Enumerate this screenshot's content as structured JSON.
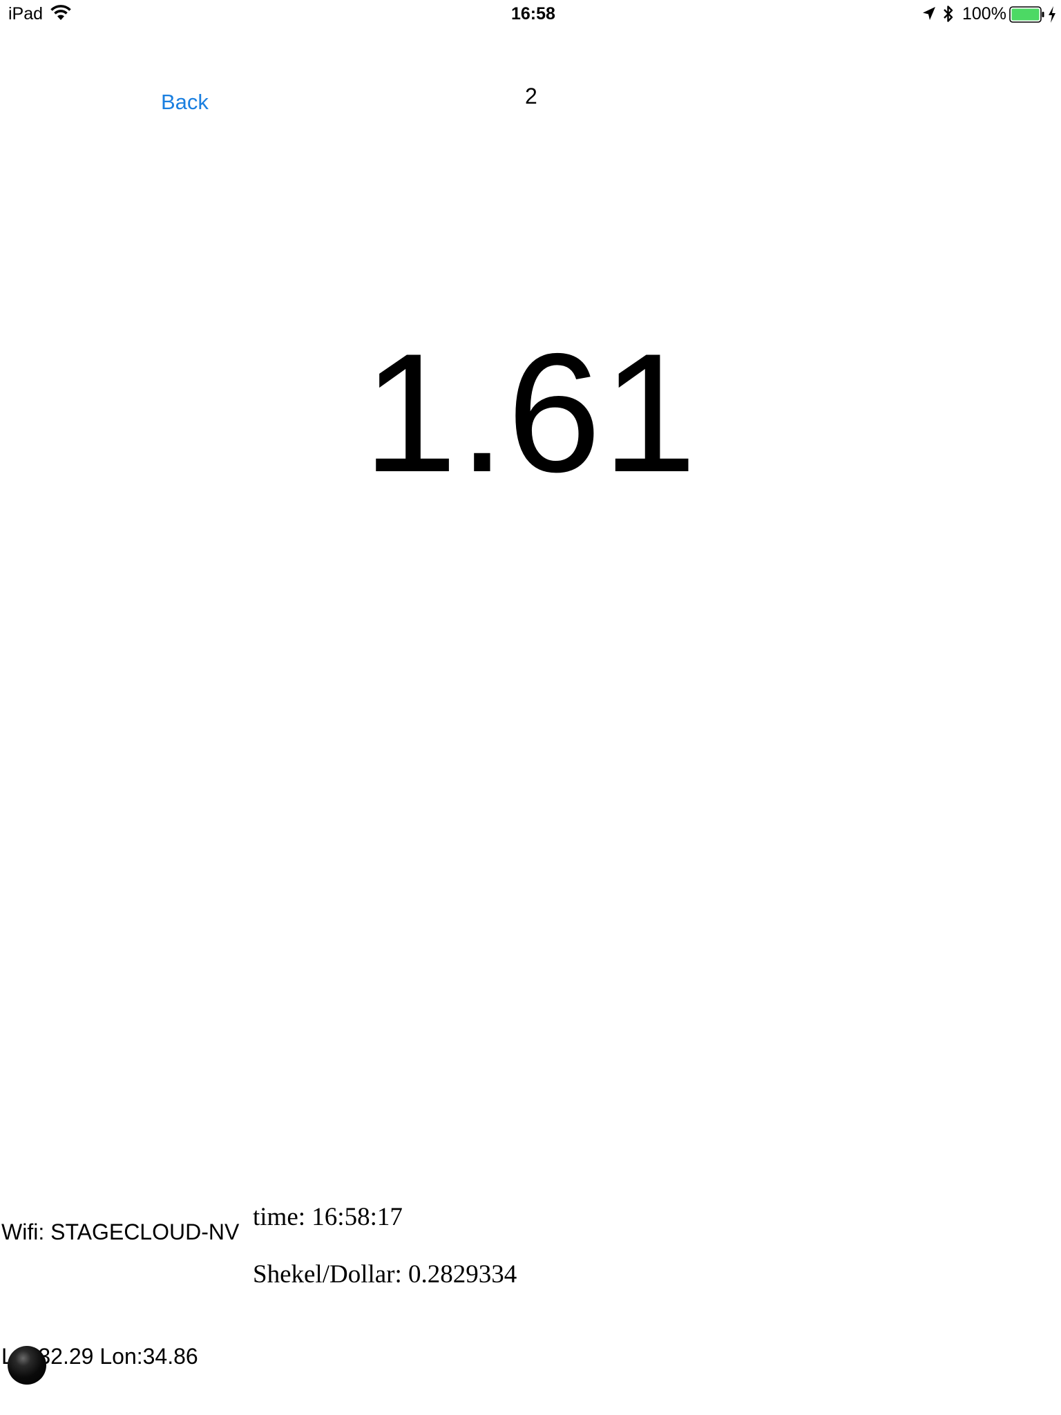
{
  "status_bar": {
    "device": "iPad",
    "time": "16:58",
    "battery_percent": "100%",
    "battery_level": 1.0,
    "battery_color": "#4cd964",
    "icons": [
      "wifi-icon",
      "location-arrow-icon",
      "bluetooth-icon",
      "battery-icon",
      "charging-bolt-icon"
    ]
  },
  "header": {
    "back_label": "Back",
    "page_number": "2",
    "accent_color": "#1a7fe0"
  },
  "main": {
    "value": "1.61"
  },
  "info": {
    "wifi": "Wifi: STAGECLOUD-NV",
    "time": "time: 16:58:17",
    "rate": "Shekel/Dollar: 0.2829334",
    "coordinates": "Lat:32.29 Lon:34.86"
  },
  "ball": {
    "icon": "black-ball-icon",
    "color": "#000000"
  }
}
